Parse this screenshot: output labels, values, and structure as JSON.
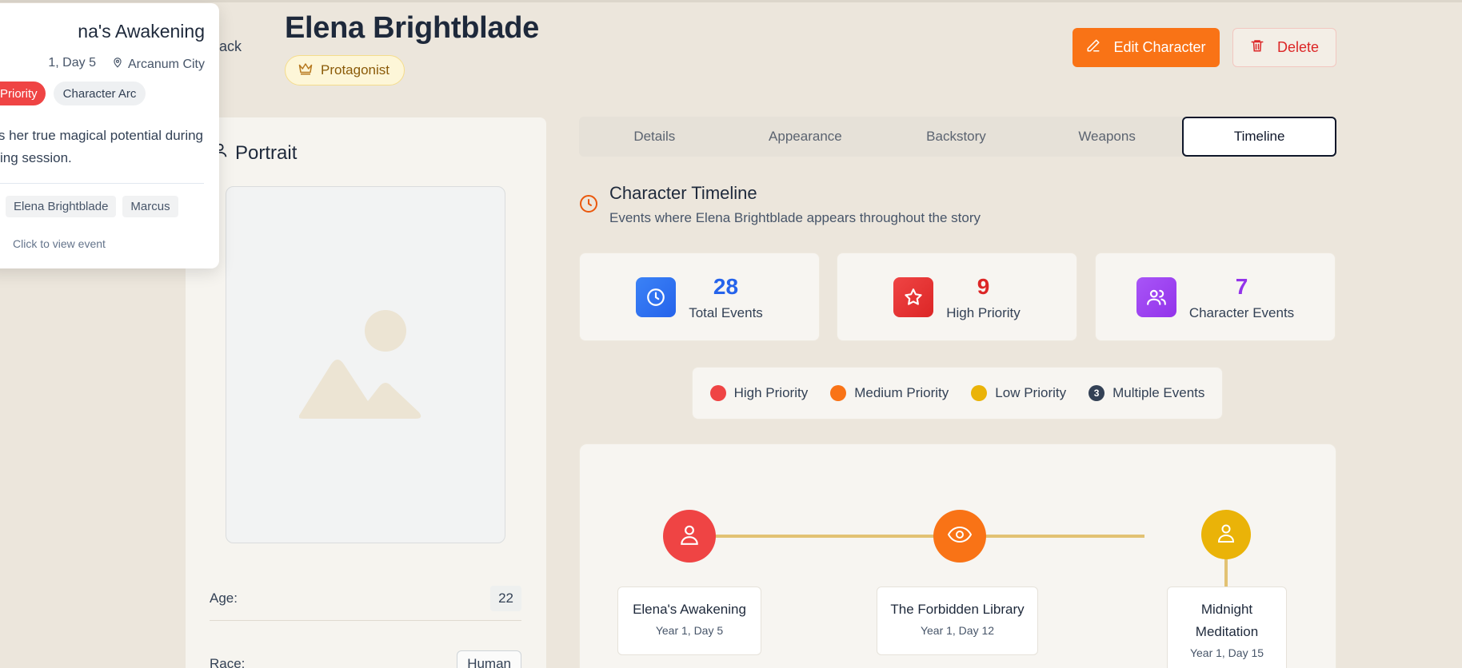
{
  "header": {
    "back_label": "Back",
    "title": "Elena Brightblade",
    "role_badge": "Protagonist",
    "edit_label": "Edit Character",
    "delete_label": "Delete"
  },
  "popup": {
    "title": "na's Awakening",
    "date": "1, Day 5",
    "location": "Arcanum City",
    "tags": [
      "Priority",
      "Character Arc"
    ],
    "description_lines": [
      "rs her true magical potential during",
      "ing session."
    ],
    "characters": [
      "Elena Brightblade",
      "Marcus"
    ],
    "hint": "Click to view event"
  },
  "portrait": {
    "heading": "Portrait",
    "fields": [
      {
        "label": "Age:",
        "value": "22"
      },
      {
        "label": "Race:",
        "value": "Human"
      }
    ]
  },
  "tabs": [
    "Details",
    "Appearance",
    "Backstory",
    "Weapons",
    "Timeline"
  ],
  "active_tab": "Timeline",
  "timeline": {
    "title": "Character Timeline",
    "subtitle": "Events where Elena Brightblade appears throughout the story"
  },
  "stats": [
    {
      "value": "28",
      "label": "Total Events",
      "color": "#2563eb",
      "icon": "clock-icon"
    },
    {
      "value": "9",
      "label": "High Priority",
      "color": "#dc2626",
      "icon": "star-icon"
    },
    {
      "value": "7",
      "label": "Character Events",
      "color": "#9333ea",
      "icon": "users-icon"
    }
  ],
  "legend": [
    {
      "label": "High Priority",
      "color": "#ef4444"
    },
    {
      "label": "Medium Priority",
      "color": "#f97316"
    },
    {
      "label": "Low Priority",
      "color": "#eab308"
    },
    {
      "label": "Multiple Events",
      "count": "3",
      "color": "#334155"
    }
  ],
  "events": [
    {
      "title": "Elena's Awakening",
      "date": "Year 1, Day 5",
      "color": "#ef4444",
      "icon": "user-icon"
    },
    {
      "title": "The Forbidden Library",
      "date": "Year 1, Day 12",
      "color": "#f97316",
      "icon": "eye-icon"
    },
    {
      "title": "Midnight Meditation",
      "date": "Year 1, Day 15",
      "color": "#eab308",
      "icon": "user-icon"
    }
  ]
}
